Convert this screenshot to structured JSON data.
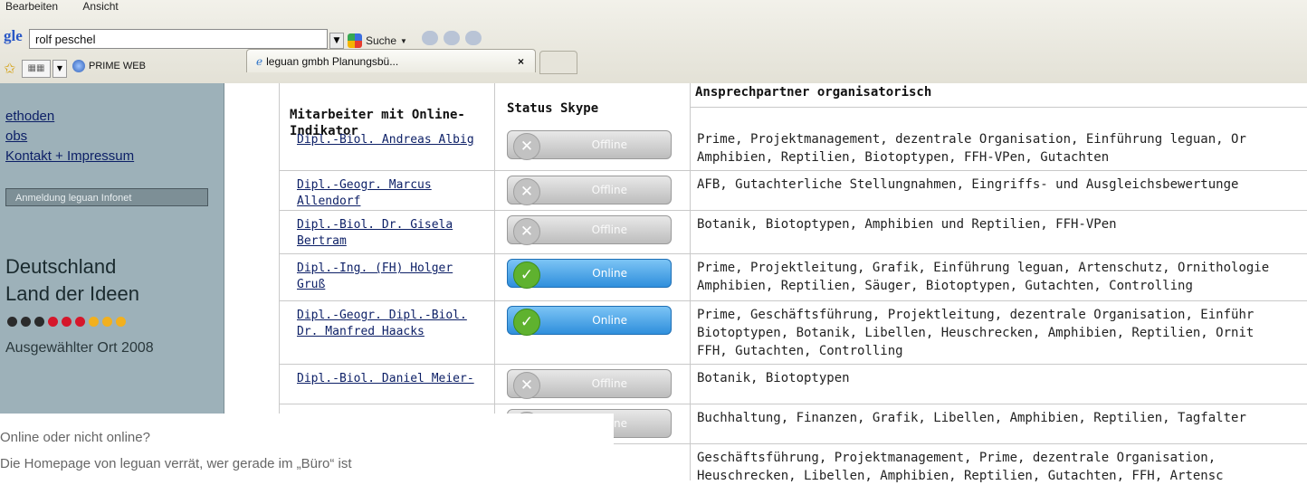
{
  "browser": {
    "menu": [
      "Bearbeiten",
      "Ansicht"
    ],
    "google_logo": "gle",
    "search_value": "rolf peschel",
    "search_button_label": "Suche",
    "favorites_item": "PRIME WEB",
    "tab_title": "leguan gmbh Planungsbü...",
    "tab_close": "×"
  },
  "sidebar": {
    "nav": [
      "ethoden",
      "obs",
      "Kontakt + Impressum"
    ],
    "login_button": "Anmeldung leguan Infonet",
    "title_line1": "Deutschland",
    "title_line2": "Land der Ideen",
    "subtitle": "Ausgewählter Ort 2008",
    "dot_colors": [
      "#2b2b2b",
      "#2b2b2b",
      "#2b2b2b",
      "#d5172b",
      "#d5172b",
      "#d5172b",
      "#f2b01e",
      "#f2b01e",
      "#f2b01e"
    ]
  },
  "table": {
    "headers": {
      "employee": "Mitarbeiter mit Online-Indikator",
      "status": "Status Skype",
      "contact": "Ansprechpartner organisatorisch"
    },
    "contact_header_note": "Prime, Projektmanagement, dezentrale Organisation, Einführung leguan, Or",
    "rows": [
      {
        "name": "Dipl.-Biol. Andreas Albig",
        "status": "Offline",
        "online": false,
        "topics": [
          "Prime, Projektmanagement, dezentrale Organisation, Einführung leguan, Or",
          "Amphibien, Reptilien, Biotoptypen, FFH-VPen, Gutachten"
        ]
      },
      {
        "name": "Dipl.-Geogr. Marcus Allendorf",
        "status": "Offline",
        "online": false,
        "topics": [
          "AFB, Gutachterliche Stellungnahmen, Eingriffs- und Ausgleichsbewertunge"
        ]
      },
      {
        "name": "Dipl.-Biol. Dr. Gisela Bertram",
        "status": "Offline",
        "online": false,
        "topics": [
          "Botanik, Biotoptypen, Amphibien und Reptilien, FFH-VPen"
        ]
      },
      {
        "name": "Dipl.-Ing. (FH) Holger Gruß",
        "status": "Online",
        "online": true,
        "topics": [
          "Prime, Projektleitung, Grafik, Einführung leguan, Artenschutz, Ornithologie",
          "Amphibien, Reptilien, Säuger, Biotoptypen, Gutachten, Controlling"
        ]
      },
      {
        "name": "Dipl.-Geogr. Dipl.-Biol. Dr. Manfred Haacks",
        "status": "Online",
        "online": true,
        "topics": [
          "Prime, Geschäftsführung, Projektleitung, dezentrale Organisation, Einführ",
          "Biotoptypen, Botanik, Libellen, Heuschrecken, Amphibien, Reptilien, Ornit",
          "FFH, Gutachten, Controlling"
        ]
      },
      {
        "name": "Dipl.-Biol. Daniel Meier-",
        "status": "Offline",
        "online": false,
        "topics": [
          "Botanik, Biotoptypen"
        ]
      },
      {
        "name": "",
        "status": "Offline",
        "online": false,
        "topics": [
          "Buchhaltung, Finanzen, Grafik, Libellen, Amphibien, Reptilien, Tagfalter"
        ]
      },
      {
        "name": "",
        "status": "",
        "online": false,
        "topics": [
          "Geschäftsführung, Projektmanagement, Prime, dezentrale Organisation,",
          "Heuschrecken, Libellen, Amphibien, Reptilien, Gutachten, FFH, Artensc"
        ]
      }
    ]
  },
  "caption": {
    "line1": "Online oder nicht online?",
    "line2": "Die Homepage von leguan verrät, wer gerade im „Büro“ ist"
  }
}
